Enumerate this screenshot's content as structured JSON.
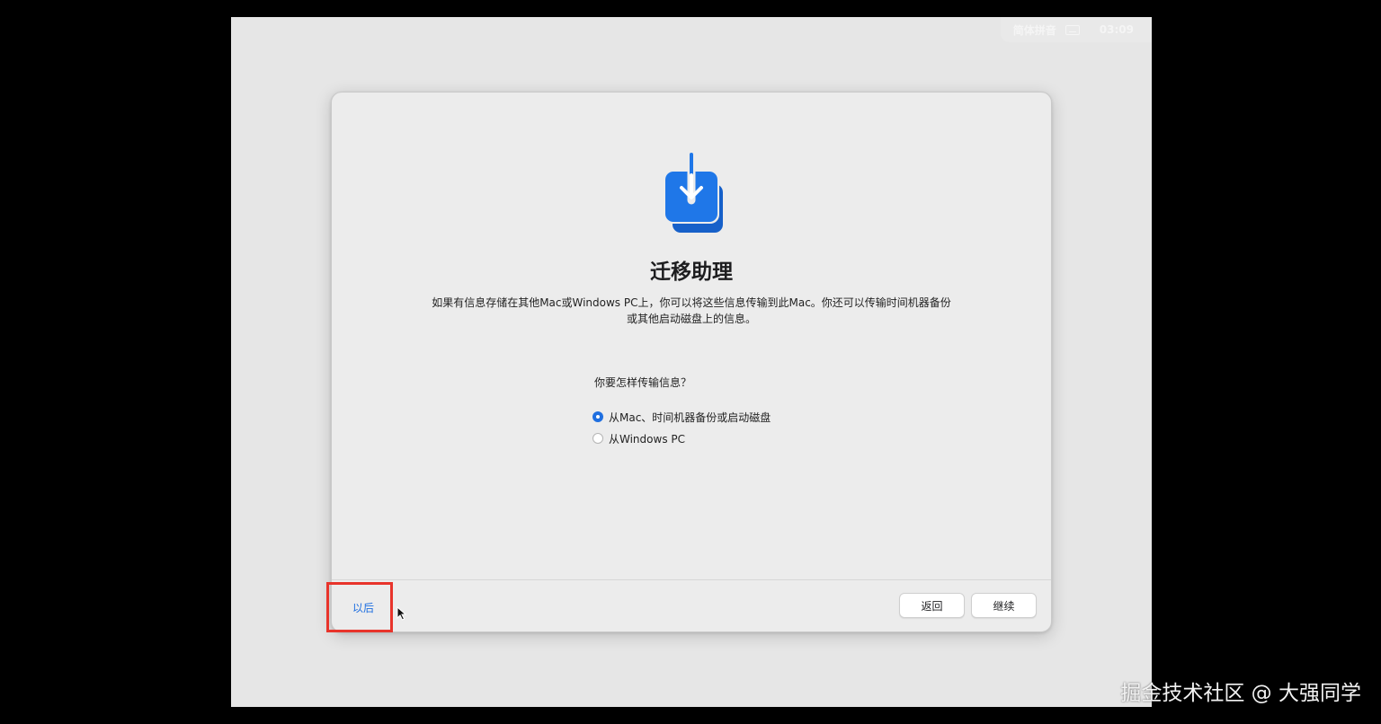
{
  "status_bar": {
    "input_method": "简体拼音",
    "keyboard_icon": "keyboard-icon",
    "time": "03:09"
  },
  "dialog": {
    "icon": "migration-download-icon",
    "title": "迁移助理",
    "description": "如果有信息存储在其他Mac或Windows PC上，你可以将这些信息传输到此Mac。你还可以传输时间机器备份或其他启动磁盘上的信息。",
    "question": "你要怎样传输信息？",
    "options": [
      {
        "label": "从Mac、时间机器备份或启动磁盘",
        "selected": true
      },
      {
        "label": "从Windows PC",
        "selected": false
      }
    ],
    "buttons": {
      "later": "以后",
      "back": "返回",
      "continue": "继续"
    }
  },
  "watermark": "掘金技术社区 @ 大强同学",
  "colors": {
    "accent": "#1f6fe0",
    "highlight": "#e8342b",
    "background": "#e6e6e6"
  }
}
